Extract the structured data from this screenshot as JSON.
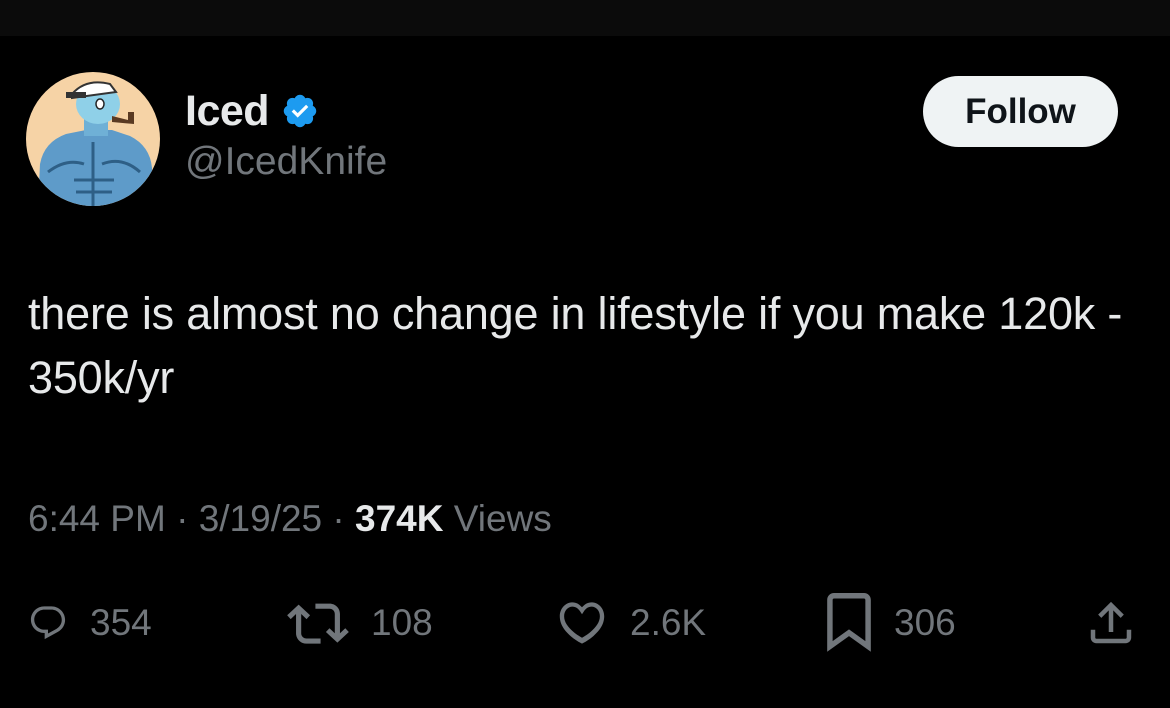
{
  "user": {
    "display_name": "Iced",
    "handle": "@IcedKnife",
    "verified_icon": "verified-badge-icon",
    "avatar_description_icon": "avatar"
  },
  "follow_button": {
    "label": "Follow"
  },
  "tweet": {
    "text": "there is almost no change in lifestyle if you make 120k - 350k/yr"
  },
  "meta": {
    "time": "6:44 PM",
    "date": "3/19/25",
    "views_count": "374K",
    "views_label": "Views",
    "separator": "·"
  },
  "actions": {
    "replies": "354",
    "reposts": "108",
    "likes": "2.6K",
    "bookmarks": "306"
  },
  "colors": {
    "background": "#000000",
    "primary_text": "#e7e9ea",
    "secondary_text": "#71767b",
    "verified_blue": "#1d9bf0",
    "follow_button_bg": "#eff3f4"
  }
}
